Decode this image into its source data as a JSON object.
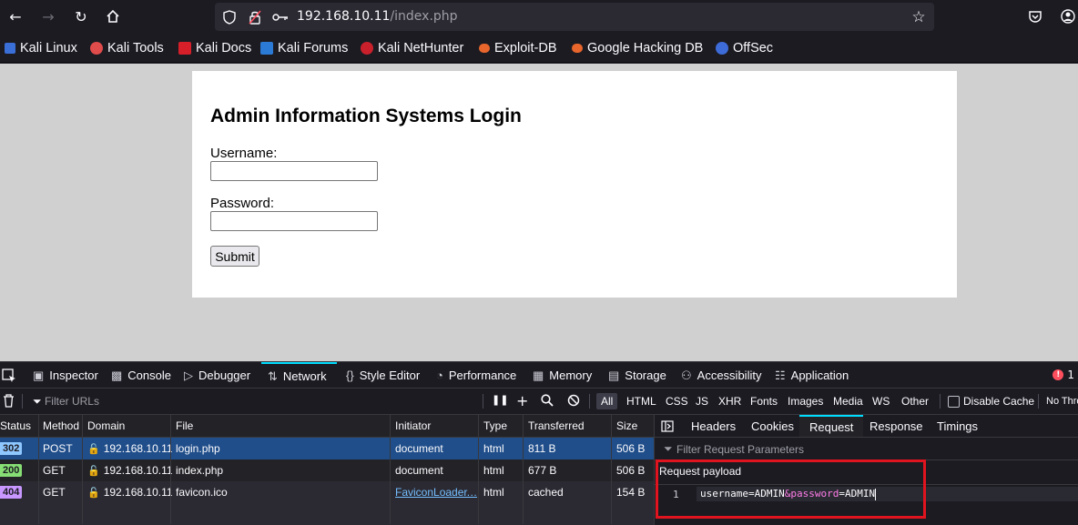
{
  "browser": {
    "url_host": "192.168.10.11",
    "url_path": "/index.php",
    "bookmarks": [
      "Kali Linux",
      "Kali Tools",
      "Kali Docs",
      "Kali Forums",
      "Kali NetHunter",
      "Exploit-DB",
      "Google Hacking DB",
      "OffSec"
    ]
  },
  "page": {
    "title": "Admin Information Systems Login",
    "username_label": "Username:",
    "password_label": "Password:",
    "submit_label": "Submit"
  },
  "devtools": {
    "tabs": [
      "Inspector",
      "Console",
      "Debugger",
      "Network",
      "Style Editor",
      "Performance",
      "Memory",
      "Storage",
      "Accessibility",
      "Application"
    ],
    "active_tab": "Network",
    "error_count": "1",
    "filter_placeholder": "Filter URLs",
    "type_filters": [
      "All",
      "HTML",
      "CSS",
      "JS",
      "XHR",
      "Fonts",
      "Images",
      "Media",
      "WS",
      "Other"
    ],
    "disable_cache_label": "Disable Cache",
    "throttle_label": "No Thro",
    "columns": [
      "Status",
      "Method",
      "Domain",
      "File",
      "Initiator",
      "Type",
      "Transferred",
      "Size"
    ],
    "requests": [
      {
        "status": "302",
        "method": "POST",
        "domain": "192.168.10.11",
        "file": "login.php",
        "initiator": "document",
        "type": "html",
        "transferred": "811 B",
        "size": "506 B"
      },
      {
        "status": "200",
        "method": "GET",
        "domain": "192.168.10.11",
        "file": "index.php",
        "initiator": "document",
        "type": "html",
        "transferred": "677 B",
        "size": "506 B"
      },
      {
        "status": "404",
        "method": "GET",
        "domain": "192.168.10.11",
        "file": "favicon.ico",
        "initiator": "FaviconLoader.…",
        "type": "html",
        "transferred": "cached",
        "size": "154 B"
      }
    ],
    "side_tabs": [
      "Headers",
      "Cookies",
      "Request",
      "Response",
      "Timings"
    ],
    "active_side_tab": "Request",
    "filter_params_placeholder": "Filter Request Parameters",
    "payload_title": "Request payload",
    "payload_line_number": "1",
    "payload": {
      "k1": "username",
      "v1": "=ADMIN",
      "amp": "&",
      "k2": "password",
      "v2": "=ADMIN"
    }
  },
  "colors": {
    "status_302": "#8fc7ff",
    "status_200": "#86de74",
    "status_404": "#c897ff",
    "accent": "#00ddff",
    "highlight_box": "#e0141e"
  }
}
